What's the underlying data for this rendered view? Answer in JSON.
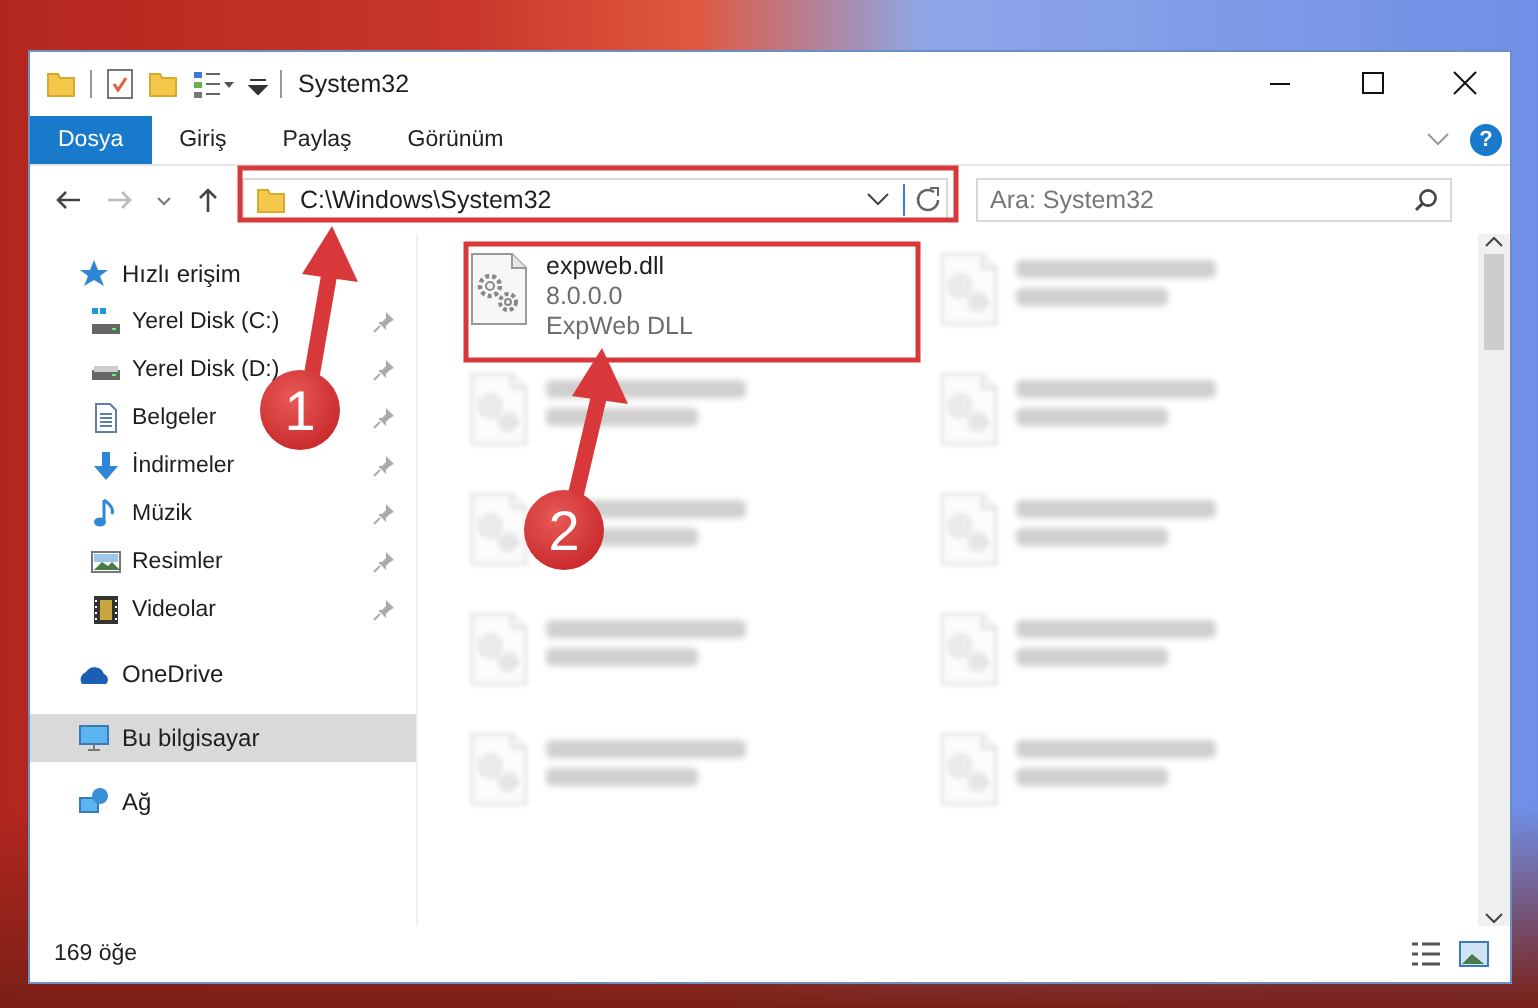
{
  "window": {
    "title": "System32"
  },
  "ribbon": {
    "tabs": [
      {
        "label": "Dosya",
        "selected": true
      },
      {
        "label": "Giriş",
        "selected": false
      },
      {
        "label": "Paylaş",
        "selected": false
      },
      {
        "label": "Görünüm",
        "selected": false
      }
    ],
    "help": "?"
  },
  "address_bar": {
    "path": "C:\\Windows\\System32"
  },
  "search": {
    "placeholder": "Ara: System32"
  },
  "sidebar": {
    "items": [
      {
        "label": "Hızlı erişim",
        "kind": "star",
        "selected": false,
        "children": [
          {
            "label": "Yerel Disk (C:)",
            "kind": "system-drive",
            "pinned": true
          },
          {
            "label": "Yerel Disk (D:)",
            "kind": "drive",
            "pinned": true
          },
          {
            "label": "Belgeler",
            "kind": "documents",
            "pinned": true
          },
          {
            "label": "İndirmeler",
            "kind": "downloads",
            "pinned": true
          },
          {
            "label": "Müzik",
            "kind": "music",
            "pinned": true
          },
          {
            "label": "Resimler",
            "kind": "pictures",
            "pinned": true
          },
          {
            "label": "Videolar",
            "kind": "videos",
            "pinned": true
          }
        ]
      },
      {
        "label": "OneDrive",
        "kind": "cloud",
        "selected": false
      },
      {
        "label": "Bu bilgisayar",
        "kind": "computer",
        "selected": true
      },
      {
        "label": "Ağ",
        "kind": "network",
        "selected": false
      }
    ]
  },
  "files": [
    {
      "name": "expweb.dll",
      "version": "8.0.0.0",
      "description": "ExpWeb DLL",
      "blurred": false
    },
    {
      "blurred": true
    },
    {
      "blurred": true
    },
    {
      "blurred": true
    },
    {
      "blurred": true
    },
    {
      "blurred": true
    },
    {
      "blurred": true
    },
    {
      "blurred": true
    },
    {
      "blurred": true
    },
    {
      "blurred": true
    }
  ],
  "status_bar": {
    "item_count": "169 öğe"
  },
  "annotations": [
    {
      "label": "1"
    },
    {
      "label": "2"
    }
  ]
}
